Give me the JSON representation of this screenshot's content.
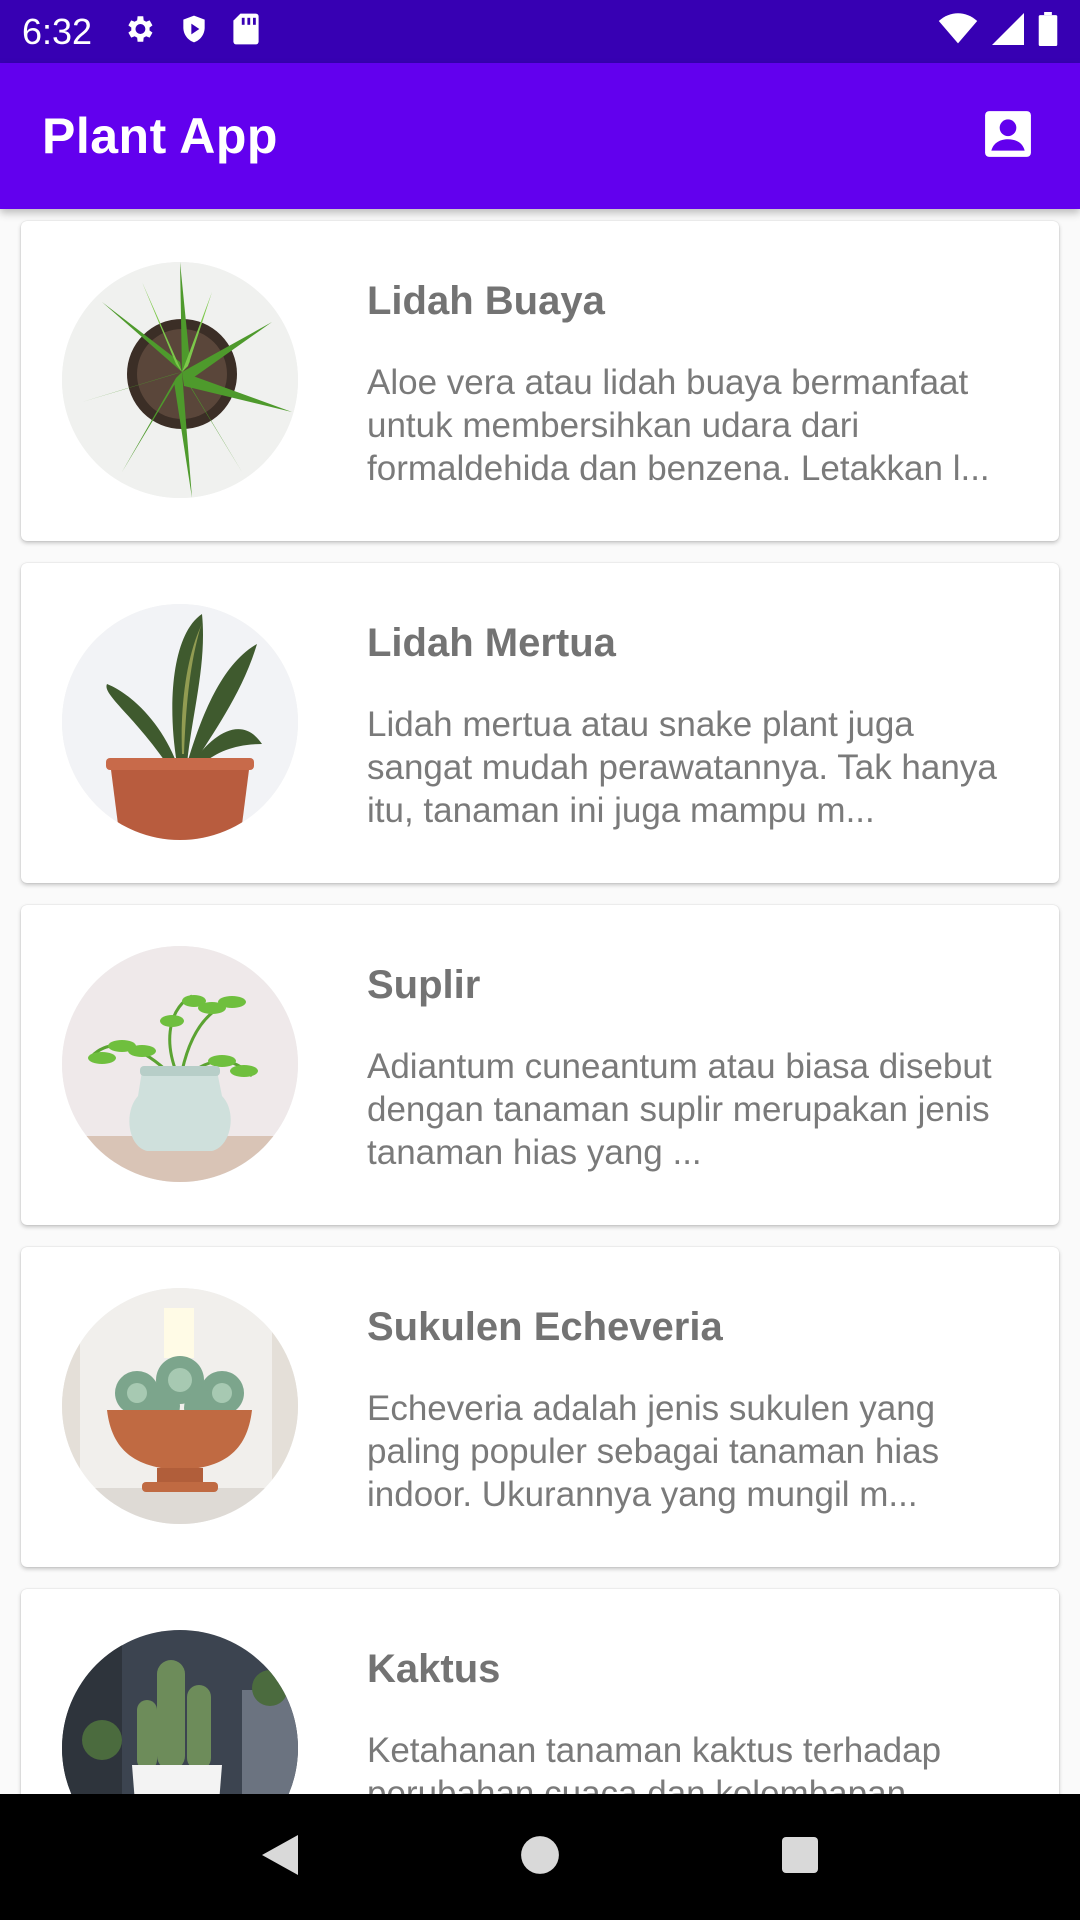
{
  "status_bar": {
    "time": "6:32",
    "left_icons": [
      "settings-icon",
      "play-protect-icon",
      "sd-card-icon"
    ],
    "right_icons": [
      "wifi-icon",
      "signal-icon",
      "battery-icon"
    ]
  },
  "app_bar": {
    "title": "Plant App",
    "action_icon": "account-box-icon",
    "color": "#6200ee",
    "status_color": "#3700b3"
  },
  "plants": [
    {
      "name": "Lidah Buaya",
      "description": "Aloe vera atau lidah buaya bermanfaat untuk membersihkan udara dari formaldehida dan benzena. Letakkan l..."
    },
    {
      "name": "Lidah Mertua",
      "description": "Lidah mertua atau snake plant juga sangat mudah perawatannya. Tak hanya itu, tanaman ini juga mampu m..."
    },
    {
      "name": "Suplir",
      "description": "Adiantum cuneantum atau biasa disebut dengan tanaman suplir merupakan jenis tanaman hias yang ..."
    },
    {
      "name": "Sukulen Echeveria",
      "description": "Echeveria adalah jenis sukulen yang paling populer sebagai tanaman hias indoor. Ukurannya yang mungil m..."
    },
    {
      "name": "Kaktus",
      "description": "Ketahanan tanaman kaktus terhadap perubahan cuaca dan kelembapan"
    }
  ],
  "nav_bar": {
    "buttons": [
      "back-icon",
      "home-icon",
      "recents-icon"
    ]
  }
}
